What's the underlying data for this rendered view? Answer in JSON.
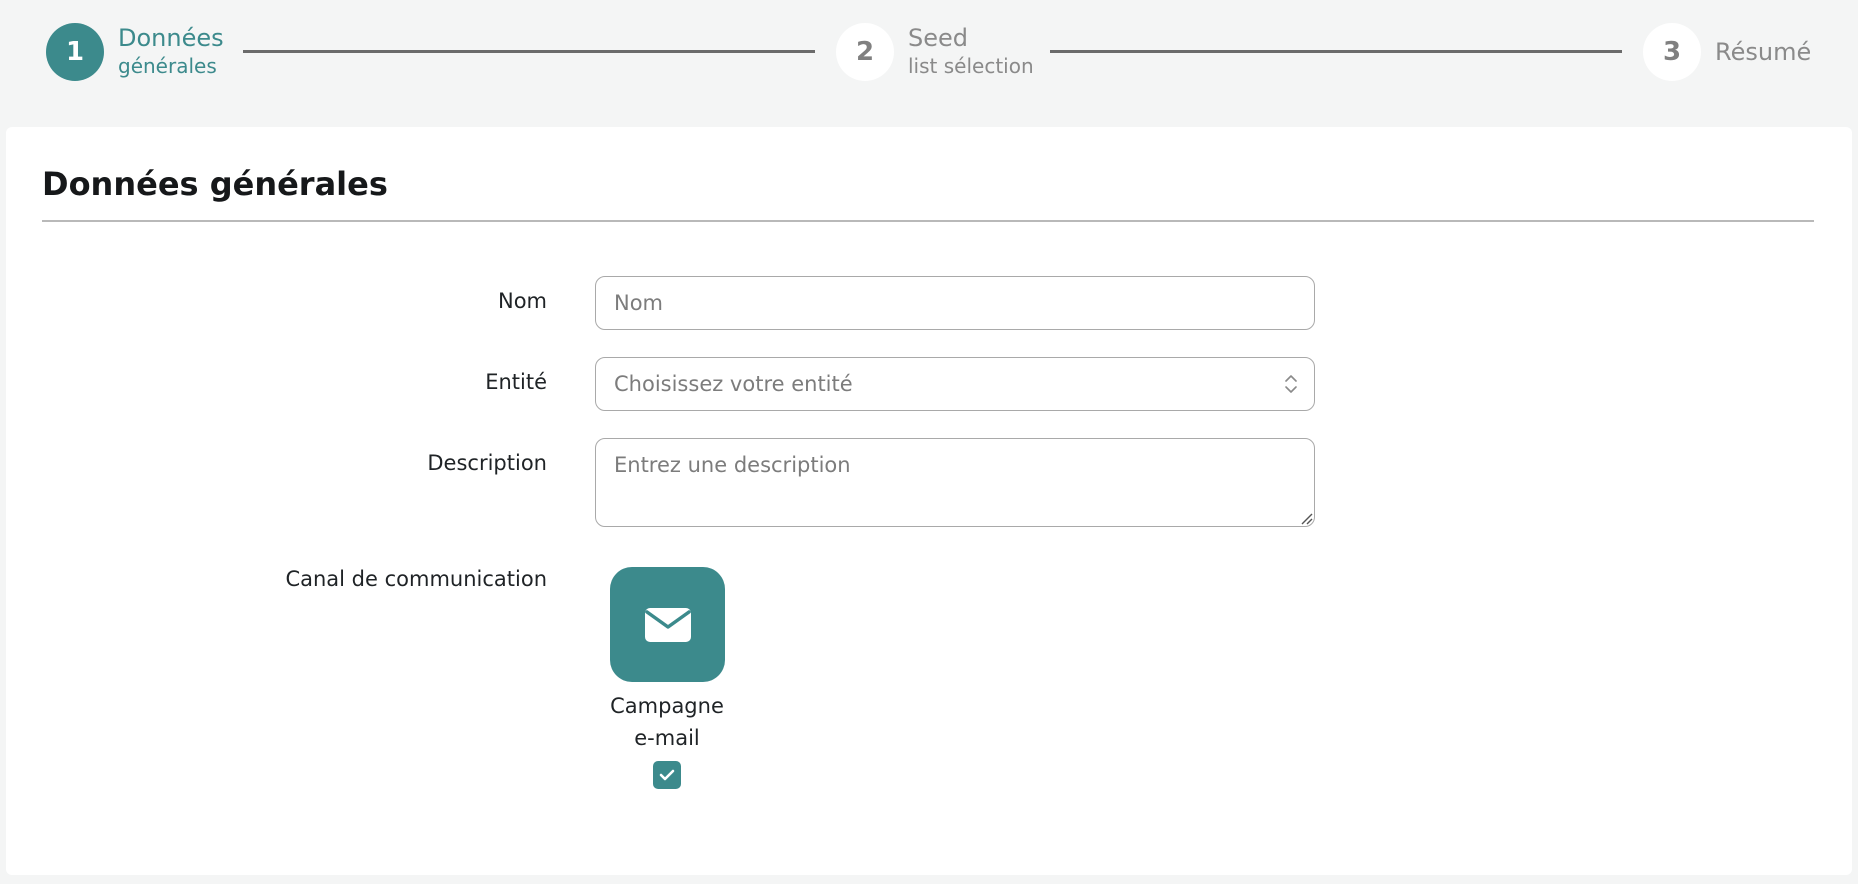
{
  "stepper": {
    "steps": [
      {
        "number": "1",
        "title": "Données",
        "subtitle": "générales",
        "state": "active"
      },
      {
        "number": "2",
        "title": "Seed",
        "subtitle": "list sélection",
        "state": "inactive"
      },
      {
        "number": "3",
        "title": "Résumé",
        "subtitle": "",
        "state": "inactive"
      }
    ]
  },
  "form": {
    "section_title": "Données générales",
    "fields": {
      "nom": {
        "label": "Nom",
        "placeholder": "Nom",
        "value": ""
      },
      "entite": {
        "label": "Entité",
        "placeholder": "Choisissez votre entité",
        "value": ""
      },
      "description": {
        "label": "Description",
        "placeholder": "Entrez une description",
        "value": ""
      }
    },
    "canal": {
      "label": "Canal de communication",
      "options": [
        {
          "label_line1": "Campagne",
          "label_line2": "e-mail",
          "icon": "envelope-icon",
          "checked": true
        }
      ]
    }
  },
  "colors": {
    "accent": "#3c8a8c",
    "page_background": "#f4f5f5",
    "inactive_step": "#8a8a8a"
  }
}
